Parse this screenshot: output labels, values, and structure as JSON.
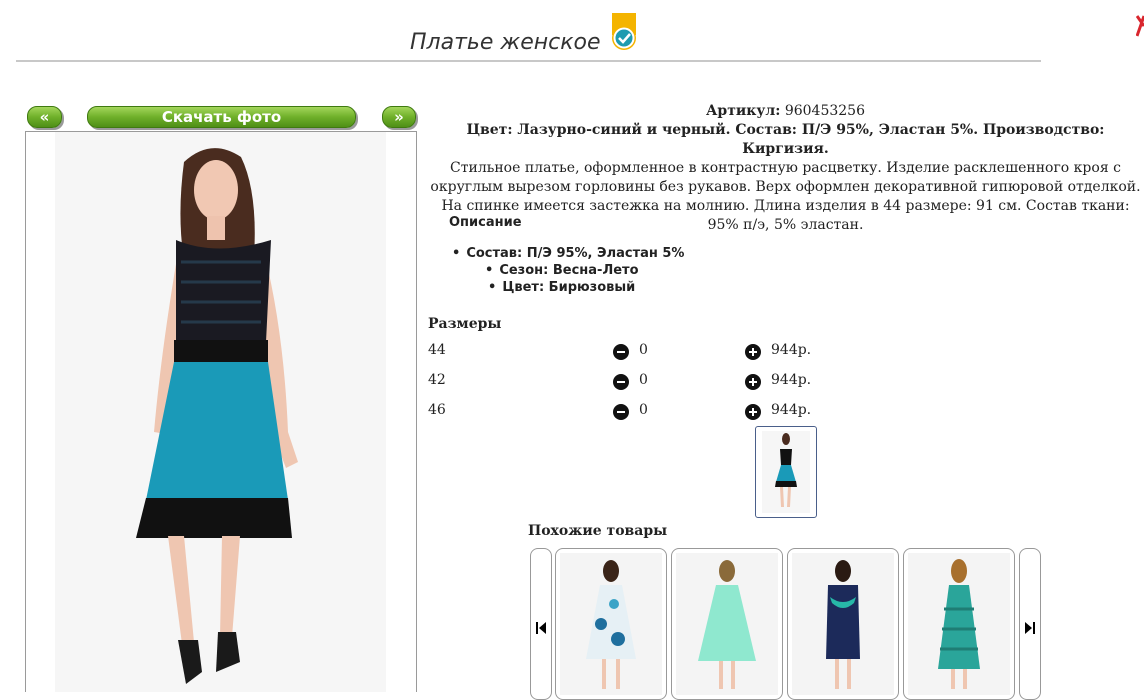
{
  "page": {
    "title": "Платье женское",
    "verified_icon": "verified-check-badge-icon"
  },
  "photo_nav": {
    "prev_label": "«",
    "download_label": "Скачать фото",
    "next_label": "»"
  },
  "product": {
    "article_label": "Артикул:",
    "article_value": "960453256",
    "summary": "Цвет: Лазурно-синий и черный. Состав: П/Э 95%, Эластан 5%. Производство: Киргизия.",
    "description": "Стильное платье, оформленное в контрастную расцветку. Изделие расклешенного кроя с округлым вырезом горловины без рукавов. Верх оформлен декоративной гипюровой отделкой. На спинке имеется застежка на молнию. Длина изделия в 44 размере: 91 см. Состав ткани: 95% п/э, 5% эластан."
  },
  "description_section": {
    "heading": "Описание",
    "items": [
      "Состав: П/Э 95%, Эластан 5%",
      "Сезон: Весна-Лето",
      "Цвет: Бирюзовый"
    ]
  },
  "sizes": {
    "heading": "Размеры",
    "rows": [
      {
        "size": "44",
        "qty": "0",
        "price": "944р."
      },
      {
        "size": "42",
        "qty": "0",
        "price": "944р."
      },
      {
        "size": "46",
        "qty": "0",
        "price": "944р."
      }
    ]
  },
  "similar": {
    "heading": "Похожие товары"
  },
  "colors": {
    "button_green": "#6fb02a",
    "dress_teal": "#1a9ab8",
    "dress_black": "#151515"
  }
}
